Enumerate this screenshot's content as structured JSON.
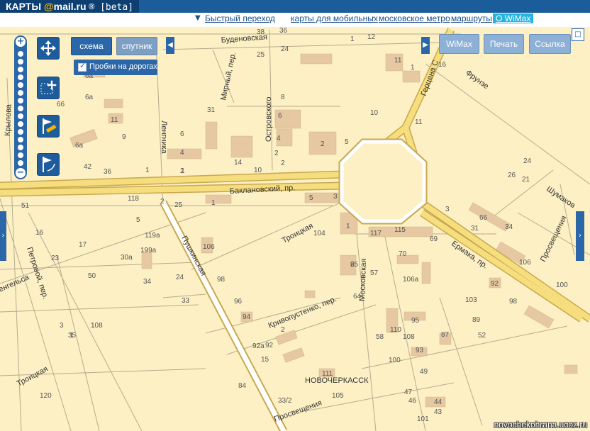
{
  "header": {
    "logo_text": "КАРТЫ",
    "logo_at": "@",
    "logo_brand": "mail.ru",
    "logo_beta": "® [beta]",
    "links": [
      {
        "label": "Быстрый переход"
      },
      {
        "label": "карты для мобильных"
      },
      {
        "label": "московское метро"
      },
      {
        "label": "маршруты"
      },
      {
        "label": "О WiMax"
      }
    ]
  },
  "controls": {
    "view_scheme": "схема",
    "view_satellite": "спутник",
    "traffic_label": "Пробки на дорогах",
    "wimax": "WiMax",
    "print": "Печать",
    "link": "Ссылка"
  },
  "map": {
    "city": "НОВОЧЕРКАССК",
    "streets": [
      "Буденовская",
      "Ленгника",
      "Мирный, пер.",
      "Островского",
      "Крылова",
      "Баклановский, пр.",
      "Троицкая",
      "Пушкинская",
      "Московская",
      "Кривопустенко, пер.",
      "Ермака, пр.",
      "Просвещения",
      "Фрунзе",
      "Герцена С",
      "Шумаков",
      "Петровой, пер.",
      "енгельса"
    ],
    "house_numbers": [
      "38",
      "36",
      "12",
      "25",
      "24",
      "1",
      "6а",
      "6а",
      "66",
      "11",
      "9",
      "6а",
      "42",
      "36",
      "1",
      "2",
      "4",
      "6",
      "31",
      "8",
      "6",
      "4",
      "2",
      "2",
      "14",
      "10",
      "2",
      "5",
      "10",
      "11",
      "1",
      "11",
      "16",
      "24",
      "26",
      "21",
      "51",
      "16",
      "23",
      "17",
      "5",
      "119а",
      "199а",
      "30а",
      "50",
      "34",
      "24",
      "33",
      "3",
      "1",
      "108",
      "106",
      "98",
      "96",
      "94",
      "92а",
      "92",
      "15",
      "2",
      "65",
      "64",
      "57",
      "58",
      "110",
      "108",
      "95",
      "93",
      "87",
      "89",
      "52",
      "49",
      "47",
      "46",
      "44",
      "43",
      "101",
      "100",
      "103",
      "98",
      "92",
      "100",
      "106",
      "106а",
      "70",
      "117",
      "115",
      "69",
      "1",
      "3",
      "5",
      "104",
      "31",
      "34",
      "66",
      "3",
      "2",
      "1",
      "35",
      "120",
      "111",
      "105",
      "84",
      "33/2",
      "118",
      "25",
      "1",
      "2",
      "1"
    ]
  },
  "footer": {
    "copyright": "novochekohrana.ucoz.ru"
  }
}
